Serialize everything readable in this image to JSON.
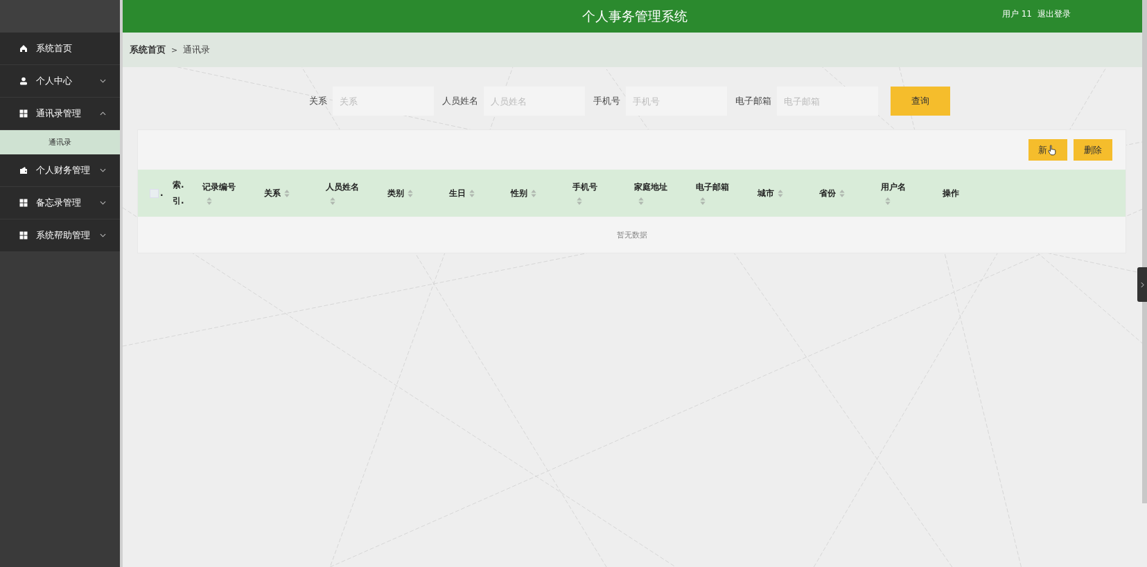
{
  "header": {
    "title": "个人事务管理系统",
    "user": "用户 11",
    "logout": "退出登录"
  },
  "sidebar": {
    "items": [
      {
        "label": "系统首页"
      },
      {
        "label": "个人中心",
        "expanded": false
      },
      {
        "label": "通讯录管理",
        "expanded": true,
        "children": [
          {
            "label": "通讯录",
            "selected": true
          }
        ]
      },
      {
        "label": "个人财务管理",
        "expanded": false
      },
      {
        "label": "备忘录管理",
        "expanded": false
      },
      {
        "label": "系统帮助管理",
        "expanded": false
      }
    ]
  },
  "breadcrumb": [
    "系统首页",
    "通讯录"
  ],
  "breadcrumb_separator": ">",
  "search": {
    "fields": [
      {
        "label": "关系",
        "placeholder": "关系"
      },
      {
        "label": "人员姓名",
        "placeholder": "人员姓名"
      },
      {
        "label": "手机号",
        "placeholder": "手机号"
      },
      {
        "label": "电子邮箱",
        "placeholder": "电子邮箱"
      }
    ],
    "button": "查询"
  },
  "toolbar": {
    "buttons": [
      {
        "label": "新",
        "cursor": true
      },
      {
        "label": "删除",
        "cursor": false
      }
    ]
  },
  "table": {
    "checkbox_label": ".",
    "checked": false,
    "index_label": "索.引.",
    "columns": [
      {
        "label": "记录编号",
        "sortable": true,
        "sort_below": true
      },
      {
        "label": "关系",
        "sortable": true,
        "sort_below": false
      },
      {
        "label": "人员姓名",
        "sortable": true,
        "sort_below": true
      },
      {
        "label": "类别",
        "sortable": true,
        "sort_below": false
      },
      {
        "label": "生日",
        "sortable": true,
        "sort_below": false
      },
      {
        "label": "性别",
        "sortable": true,
        "sort_below": false
      },
      {
        "label": "手机号",
        "sortable": true,
        "sort_below": true
      },
      {
        "label": "家庭地址",
        "sortable": true,
        "sort_below": true
      },
      {
        "label": "电子邮箱",
        "sortable": true,
        "sort_below": true
      },
      {
        "label": "城市",
        "sortable": true,
        "sort_below": false
      },
      {
        "label": "省份",
        "sortable": true,
        "sort_below": false
      },
      {
        "label": "用户名",
        "sortable": true,
        "sort_below": true
      },
      {
        "label": "操作",
        "sortable": false
      }
    ],
    "empty": "暂无数据"
  }
}
